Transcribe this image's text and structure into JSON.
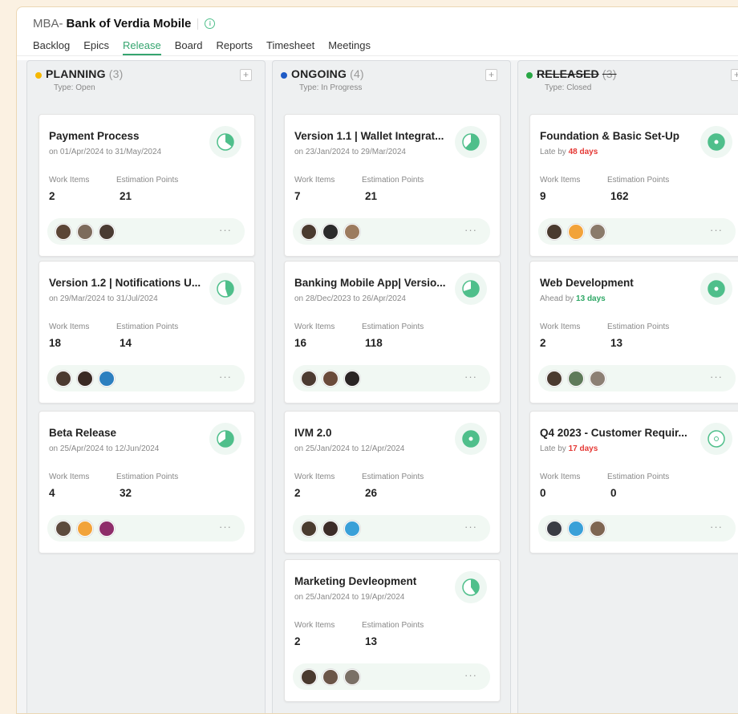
{
  "header": {
    "prefix": "MBA-",
    "project": "Bank of Verdia Mobile",
    "info_icon": "info-circle-icon"
  },
  "tabs": [
    "Backlog",
    "Epics",
    "Release",
    "Board",
    "Reports",
    "Timesheet",
    "Meetings"
  ],
  "active_tab": "Release",
  "labels": {
    "work_items": "Work Items",
    "estimation_points": "Estimation Points"
  },
  "columns": [
    {
      "name": "PLANNING",
      "count": "(3)",
      "type": "Type: Open",
      "dot_color": "#f6b800",
      "strike": false,
      "cards": [
        {
          "title": "Payment Process",
          "date": "on 01/Apr/2024 to 31/May/2024",
          "work_items": "2",
          "points": "21",
          "progress": 0.35
        },
        {
          "title": "Version 1.2 | Notifications U...",
          "date": "on 29/Mar/2024 to 31/Jul/2024",
          "work_items": "18",
          "points": "14",
          "progress": 0.45
        },
        {
          "title": "Beta Release",
          "date": "on 25/Apr/2024 to 12/Jun/2024",
          "work_items": "4",
          "points": "32",
          "progress": 0.65
        }
      ]
    },
    {
      "name": "ONGOING",
      "count": "(4)",
      "type": "Type: In Progress",
      "dot_color": "#1e5bc6",
      "strike": false,
      "cards": [
        {
          "title": "Version 1.1 | Wallet Integrat...",
          "date": "on 23/Jan/2024 to 29/Mar/2024",
          "work_items": "7",
          "points": "21",
          "progress": 0.62
        },
        {
          "title": "Banking Mobile App| Versio...",
          "date": "on 28/Dec/2023 to 26/Apr/2024",
          "work_items": "16",
          "points": "118",
          "progress": 0.7
        },
        {
          "title": "IVM 2.0",
          "date": "on 25/Jan/2024 to 12/Apr/2024",
          "work_items": "2",
          "points": "26",
          "progress": 1
        },
        {
          "title": "Marketing Devleopment",
          "date": "on 25/Jan/2024 to 19/Apr/2024",
          "work_items": "2",
          "points": "13",
          "progress": 0.4
        }
      ]
    },
    {
      "name": "RELEASED",
      "count": "(3)",
      "type": "Type: Closed",
      "dot_color": "#28a745",
      "strike": true,
      "cards": [
        {
          "title": "Foundation & Basic Set-Up",
          "date_prefix": "Late by",
          "date_value": "48 days",
          "date_kind": "late",
          "work_items": "9",
          "points": "162",
          "progress": 1
        },
        {
          "title": "Web Development",
          "date_prefix": "Ahead by",
          "date_value": "13 days",
          "date_kind": "ahead",
          "work_items": "2",
          "points": "13",
          "progress": 1
        },
        {
          "title": "Q4 2023 - Customer Requir...",
          "date_prefix": "Late by",
          "date_value": "17 days",
          "date_kind": "late",
          "work_items": "0",
          "points": "0",
          "progress": 0
        }
      ]
    }
  ],
  "colors": {
    "accent": "#35a56f",
    "pie_fill": "#4fbf8b",
    "late": "#e53935",
    "ahead": "#2fa866"
  },
  "avatar_palettes": [
    [
      "#5b4636",
      "#7d6b5c",
      "#4a3b32"
    ],
    [
      "#4b3a30",
      "#3a2a24",
      "#2d7fbf"
    ],
    [
      "#5c4a3d",
      "#f2a33a",
      "#8e2d6a"
    ],
    [
      "#4a3a2f",
      "#2b2b2b",
      "#9c7b5e"
    ],
    [
      "#4c3a31",
      "#6a4a3a",
      "#2a2424"
    ],
    [
      "#4a3b2f",
      "#3c2c28",
      "#3aa0d8"
    ],
    [
      "#4a3a2f",
      "#6b5648",
      "#7a7066"
    ],
    [
      "#4a3b2f",
      "#f2a33a",
      "#8a7a6a"
    ],
    [
      "#4a3a2f",
      "#5f7a5a",
      "#8c7f74"
    ],
    [
      "#3a3b44",
      "#3aa0d8",
      "#7e6552"
    ]
  ],
  "more_label": "···"
}
